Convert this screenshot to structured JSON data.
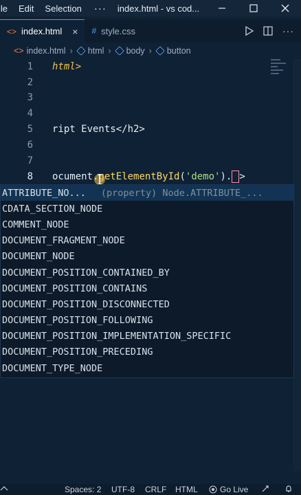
{
  "titlebar": {
    "menus": [
      "ile",
      "Edit",
      "Selection"
    ],
    "more": "···",
    "window_title": "index.html - vs cod..."
  },
  "tabs": [
    {
      "label": "index.html",
      "icon": "html-icon",
      "active": true
    },
    {
      "label": "style.css",
      "icon": "css-icon",
      "active": false
    }
  ],
  "breadcrumb": [
    "index.html",
    "html",
    "body",
    "button"
  ],
  "editor": {
    "line_numbers": [
      "1",
      "2",
      "3",
      "4",
      "5",
      "6",
      "7",
      "8"
    ],
    "current_line": "8",
    "line1": "html>",
    "line5": "ript Events</h2>",
    "line8_pre": "ocument.",
    "line8_fn": "getElementById",
    "line8_open": "(",
    "line8_str": "'demo'",
    "line8_close": ").",
    "line8_tail": ">"
  },
  "suggestions": {
    "items": [
      "ATTRIBUTE_NO...",
      "CDATA_SECTION_NODE",
      "COMMENT_NODE",
      "DOCUMENT_FRAGMENT_NODE",
      "DOCUMENT_NODE",
      "DOCUMENT_POSITION_CONTAINED_BY",
      "DOCUMENT_POSITION_CONTAINS",
      "DOCUMENT_POSITION_DISCONNECTED",
      "DOCUMENT_POSITION_FOLLOWING",
      "DOCUMENT_POSITION_IMPLEMENTATION_SPECIFIC",
      "DOCUMENT_POSITION_PRECEDING",
      "DOCUMENT_TYPE_NODE"
    ],
    "selected_detail": "(property) Node.ATTRIBUTE_..."
  },
  "statusbar": {
    "spaces": "Spaces: 2",
    "encoding": "UTF-8",
    "eol": "CRLF",
    "language": "HTML",
    "golive": "Go Live"
  },
  "colors": {
    "editor_bg": "#0f2235",
    "accent": "#3aa0ff",
    "selection": "#123353"
  }
}
